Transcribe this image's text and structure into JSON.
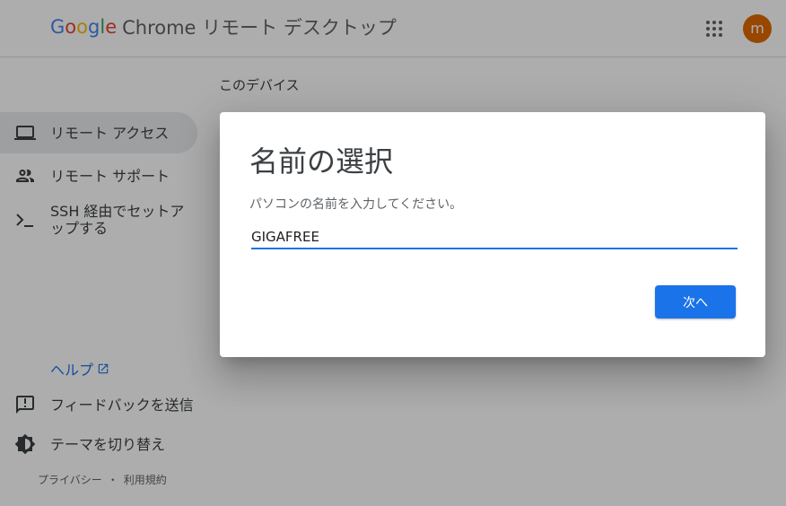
{
  "header": {
    "logo_letters": [
      "G",
      "o",
      "o",
      "g",
      "l",
      "e"
    ],
    "product_name": "Chrome リモート デスクトップ",
    "apps_icon": "apps-grid-icon",
    "avatar_initial": "m",
    "avatar_color": "#e06900"
  },
  "main": {
    "section_title": "このデバイス"
  },
  "sidebar": {
    "items": [
      {
        "label": "リモート アクセス",
        "icon": "laptop-icon",
        "active": true
      },
      {
        "label": "リモート サポート",
        "icon": "people-icon",
        "active": false
      },
      {
        "label": "SSH 経由でセットアップする",
        "icon": "terminal-icon",
        "active": false
      }
    ],
    "help_label": "ヘルプ",
    "feedback_label": "フィードバックを送信",
    "theme_label": "テーマを切り替え"
  },
  "footer": {
    "privacy_label": "プライバシー",
    "separator": "・",
    "terms_label": "利用規約"
  },
  "dialog": {
    "title": "名前の選択",
    "description": "パソコンの名前を入力してください。",
    "input_value": "GIGAFREE",
    "next_label": "次へ"
  },
  "colors": {
    "accent": "#1a73e8",
    "scrim": "rgba(0,0,0,0.32)"
  }
}
